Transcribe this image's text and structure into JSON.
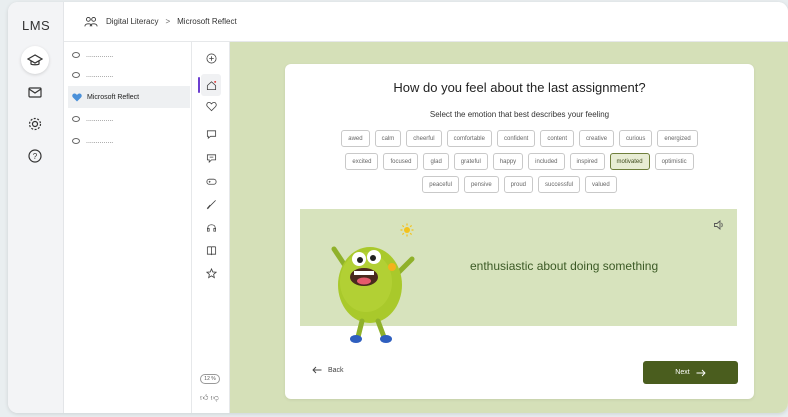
{
  "app": {
    "title": "LMS"
  },
  "breadcrumb": {
    "items": [
      "Digital Literacy",
      "Microsoft Reflect"
    ],
    "separator": ">"
  },
  "nav_tree": {
    "items": [
      {
        "label": "..............",
        "selected": false
      },
      {
        "label": "..............",
        "selected": false
      },
      {
        "label": "Microsoft Reflect",
        "selected": true
      },
      {
        "label": "..............",
        "selected": false
      },
      {
        "label": "..............",
        "selected": false
      }
    ]
  },
  "progress_badge": "12 %",
  "question": {
    "title": "How do you feel about the last assignment?",
    "subtitle": "Select the emotion that best describes your feeling"
  },
  "emotions": {
    "row1": [
      "awed",
      "calm",
      "cheerful",
      "comfortable",
      "confident",
      "content",
      "creative",
      "curious",
      "energized"
    ],
    "row2": [
      "excited",
      "focused",
      "glad",
      "grateful",
      "happy",
      "included",
      "inspired",
      "motivated",
      "optimistic"
    ],
    "row3": [
      "peaceful",
      "pensive",
      "proud",
      "successful",
      "valued"
    ],
    "selected": "motivated"
  },
  "feeling": {
    "description": "enthusiastic about doing something"
  },
  "buttons": {
    "back": "Back",
    "next": "Next"
  },
  "colors": {
    "accent": "#6c3fd0",
    "main_bg": "#d5e0b8",
    "panel_bg": "#d7e3bd",
    "next_bg": "#4a5d1e",
    "feel_text": "#3b5a25",
    "heart": "#4a90d9"
  }
}
